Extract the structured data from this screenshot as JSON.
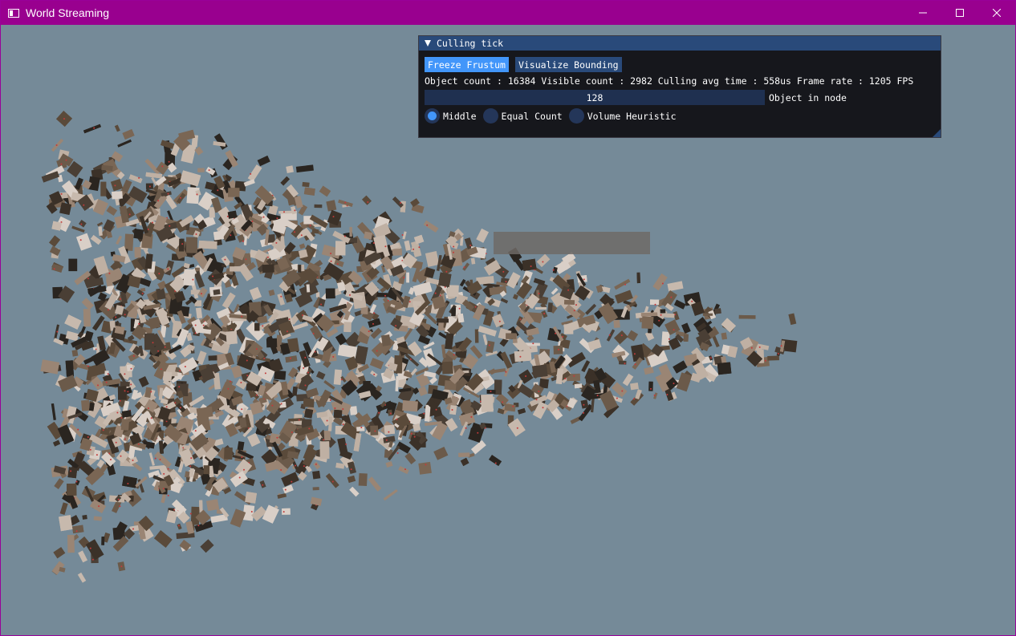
{
  "window": {
    "title": "World Streaming",
    "app_icon": "window-icon",
    "controls": [
      {
        "name": "minimize",
        "icon": "minimize-icon"
      },
      {
        "name": "maximize",
        "icon": "maximize-icon"
      },
      {
        "name": "close",
        "icon": "close-icon"
      }
    ],
    "titlebar_color": "#99008f",
    "background_color": "#758a98"
  },
  "panel": {
    "title": "Culling tick",
    "buttons": {
      "freeze": "Freeze Frustum",
      "visualize": "Visualize Bounding"
    },
    "stats": "Object count : 16384 Visible count : 2982 Culling avg time : 558us Frame rate : 1205 FPS",
    "slider": {
      "value": "128",
      "label": "Object in node"
    },
    "radios": [
      {
        "label": "Middle",
        "selected": true
      },
      {
        "label": "Equal Count",
        "selected": false
      },
      {
        "label": "Volume Heuristic",
        "selected": false
      }
    ],
    "accent_color": "#4296fa",
    "title_color": "#294a7a"
  }
}
